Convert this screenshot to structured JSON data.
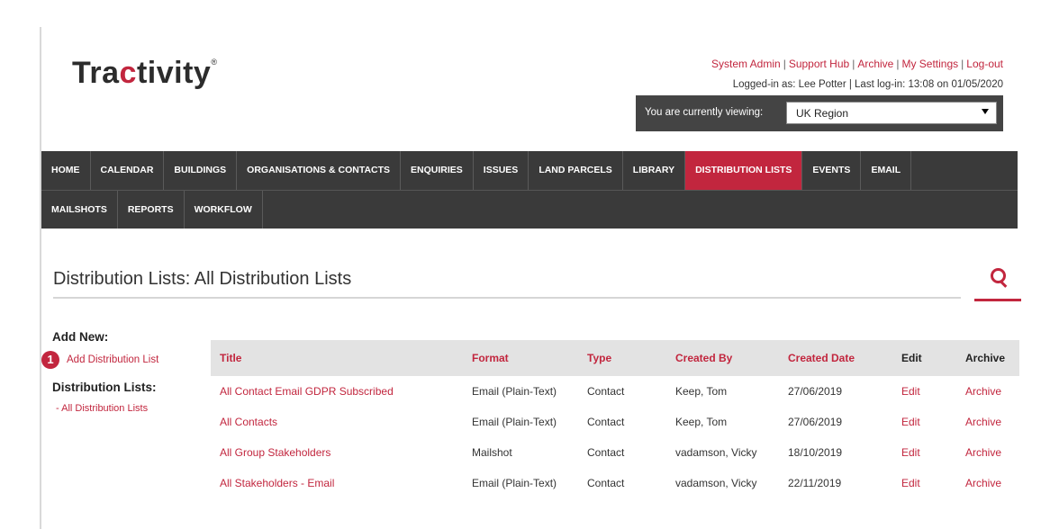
{
  "logo": {
    "text_pre": "Tra",
    "text_accent": "c",
    "text_post": "tivity",
    "mark": "®"
  },
  "toplinks": [
    "System Admin",
    "Support Hub",
    "Archive",
    "My Settings",
    "Log-out"
  ],
  "login_info": "Logged-in as: Lee Potter | Last log-in: 13:08 on 01/05/2020",
  "viewing": {
    "label": "You are currently viewing:",
    "selected": "UK Region"
  },
  "nav": {
    "row1": [
      "HOME",
      "CALENDAR",
      "BUILDINGS",
      "ORGANISATIONS & CONTACTS",
      "ENQUIRIES",
      "ISSUES",
      "LAND PARCELS",
      "LIBRARY",
      "DISTRIBUTION LISTS",
      "EVENTS",
      "EMAIL"
    ],
    "row2": [
      "MAILSHOTS",
      "REPORTS",
      "WORKFLOW"
    ],
    "active": "DISTRIBUTION LISTS"
  },
  "page_title": "Distribution Lists: All Distribution Lists",
  "sidebar": {
    "add_heading": "Add New:",
    "add_link": "Add Distribution List",
    "badge": "1",
    "lists_heading": "Distribution Lists:",
    "lists_link": "- All Distribution Lists"
  },
  "table": {
    "headers": [
      "Title",
      "Format",
      "Type",
      "Created By",
      "Created Date",
      "Edit",
      "Archive"
    ],
    "rows": [
      [
        "All Contact Email GDPR Subscribed",
        "Email (Plain-Text)",
        "Contact",
        "Keep, Tom",
        "27/06/2019",
        "Edit",
        "Archive"
      ],
      [
        "All Contacts",
        "Email (Plain-Text)",
        "Contact",
        "Keep, Tom",
        "27/06/2019",
        "Edit",
        "Archive"
      ],
      [
        "All Group Stakeholders",
        "Mailshot",
        "Contact",
        "vadamson, Vicky",
        "18/10/2019",
        "Edit",
        "Archive"
      ],
      [
        "All Stakeholders - Email",
        "Email (Plain-Text)",
        "Contact",
        "vadamson, Vicky",
        "22/11/2019",
        "Edit",
        "Archive"
      ]
    ]
  },
  "colors": {
    "accent": "#c2263e",
    "nav_bg": "#3a3a3a",
    "header_bg": "#e3e3e3"
  }
}
